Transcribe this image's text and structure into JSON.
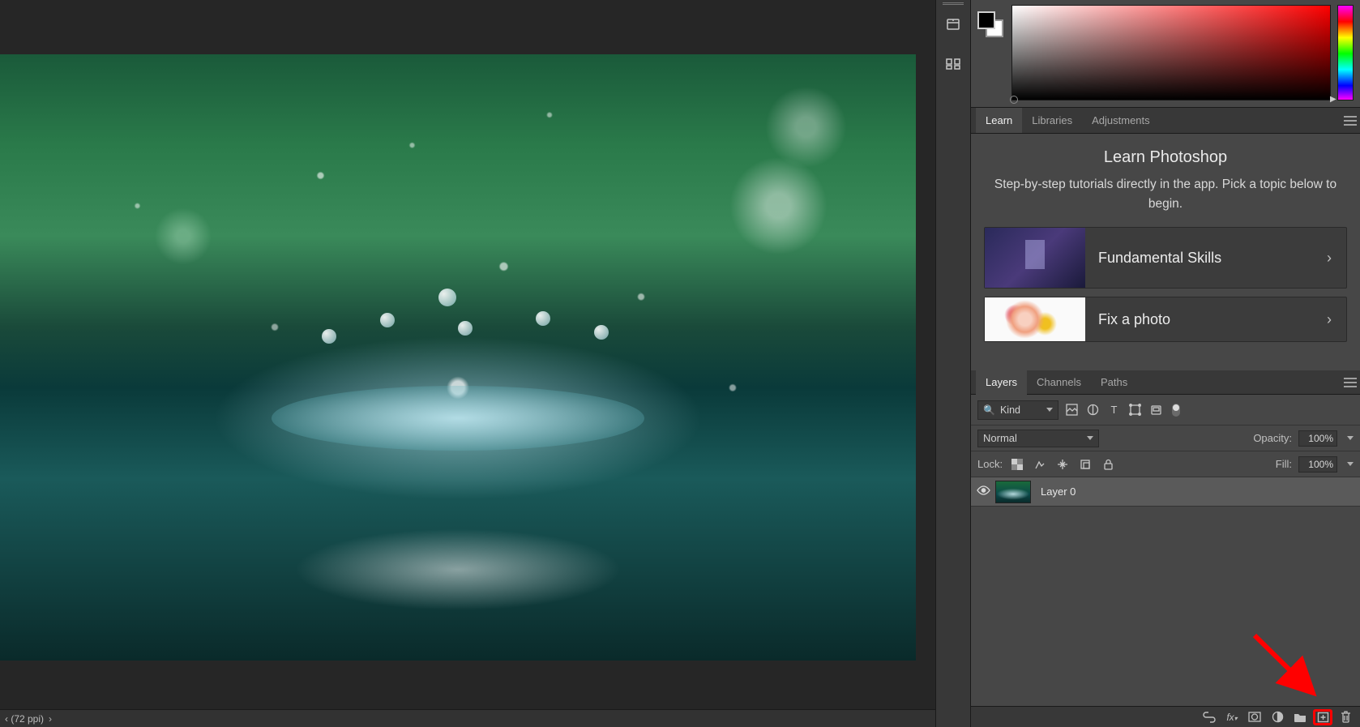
{
  "status": {
    "zoom_info": "‹ (72 ppi)",
    "chevron": "›"
  },
  "learn_tabs": {
    "learn": "Learn",
    "libraries": "Libraries",
    "adjustments": "Adjustments"
  },
  "learn": {
    "title": "Learn Photoshop",
    "desc": "Step-by-step tutorials directly in the app. Pick a topic below to begin.",
    "topic1": "Fundamental Skills",
    "topic2": "Fix a photo"
  },
  "layers_tabs": {
    "layers": "Layers",
    "channels": "Channels",
    "paths": "Paths"
  },
  "layer_filter": {
    "kind": "Kind"
  },
  "blend": {
    "mode": "Normal",
    "opacity_label": "Opacity:",
    "opacity_val": "100%"
  },
  "lock": {
    "label": "Lock:",
    "fill_label": "Fill:",
    "fill_val": "100%"
  },
  "layer0": {
    "name": "Layer 0"
  },
  "colors": {
    "fg": "#000000",
    "bg": "#ffffff"
  }
}
